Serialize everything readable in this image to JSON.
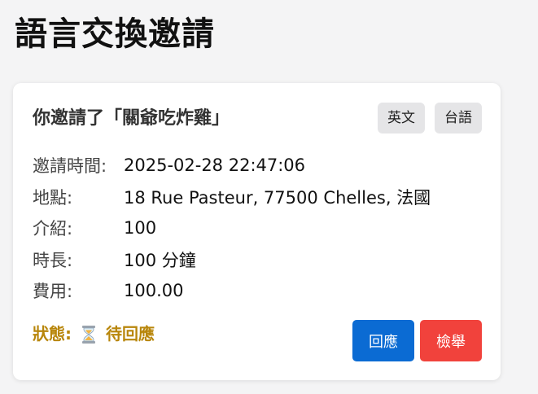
{
  "page": {
    "title": "語言交換邀請"
  },
  "card": {
    "title": "你邀請了「關爺吃炸雞」",
    "languages": [
      "英文",
      "台語"
    ],
    "details": [
      {
        "label": "邀請時間:",
        "value": "2025-02-28 22:47:06"
      },
      {
        "label": "地點:",
        "value": "18 Rue Pasteur, 77500 Chelles, 法國"
      },
      {
        "label": "介紹:",
        "value": "100"
      },
      {
        "label": "時長:",
        "value": "100 分鐘"
      },
      {
        "label": "費用:",
        "value": "100.00"
      }
    ],
    "status": {
      "label": "狀態:",
      "icon": "hourglass-icon",
      "text": "待回應",
      "color": "#b8860b"
    },
    "actions": {
      "reply_label": "回應",
      "report_label": "檢舉",
      "reply_color": "#0b6bd3",
      "report_color": "#f1423c"
    }
  }
}
